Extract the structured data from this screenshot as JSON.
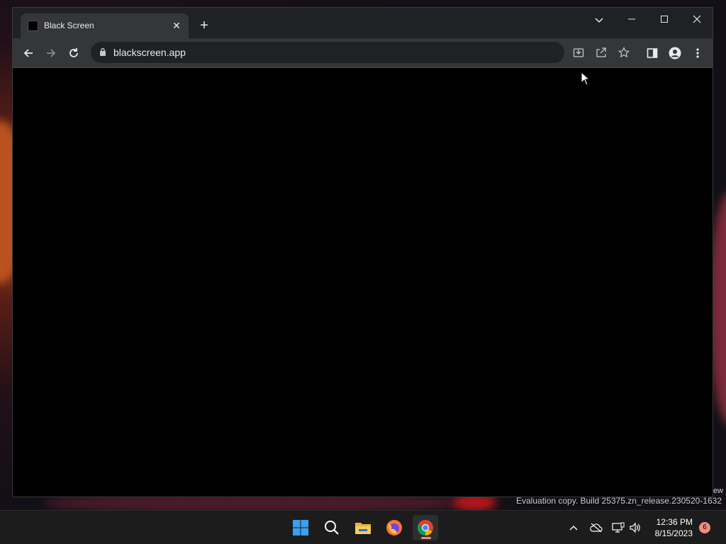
{
  "browser": {
    "tab": {
      "title": "Black Screen"
    },
    "address_bar": {
      "url": "blackscreen.app"
    }
  },
  "desktop": {
    "edge_text": "ew",
    "watermark": "Evaluation copy. Build 25375.zn_release.230520-1632"
  },
  "taskbar": {
    "apps": [
      "start",
      "search",
      "file-explorer",
      "firefox",
      "chrome"
    ],
    "clock": {
      "time": "12:36 PM",
      "date": "8/15/2023"
    },
    "notification_count": "6"
  },
  "colors": {
    "titlebar": "#202124",
    "toolbar": "#35363a",
    "page": "#000000",
    "taskbar": "#1c1c1c",
    "accent": "#f28b82"
  }
}
